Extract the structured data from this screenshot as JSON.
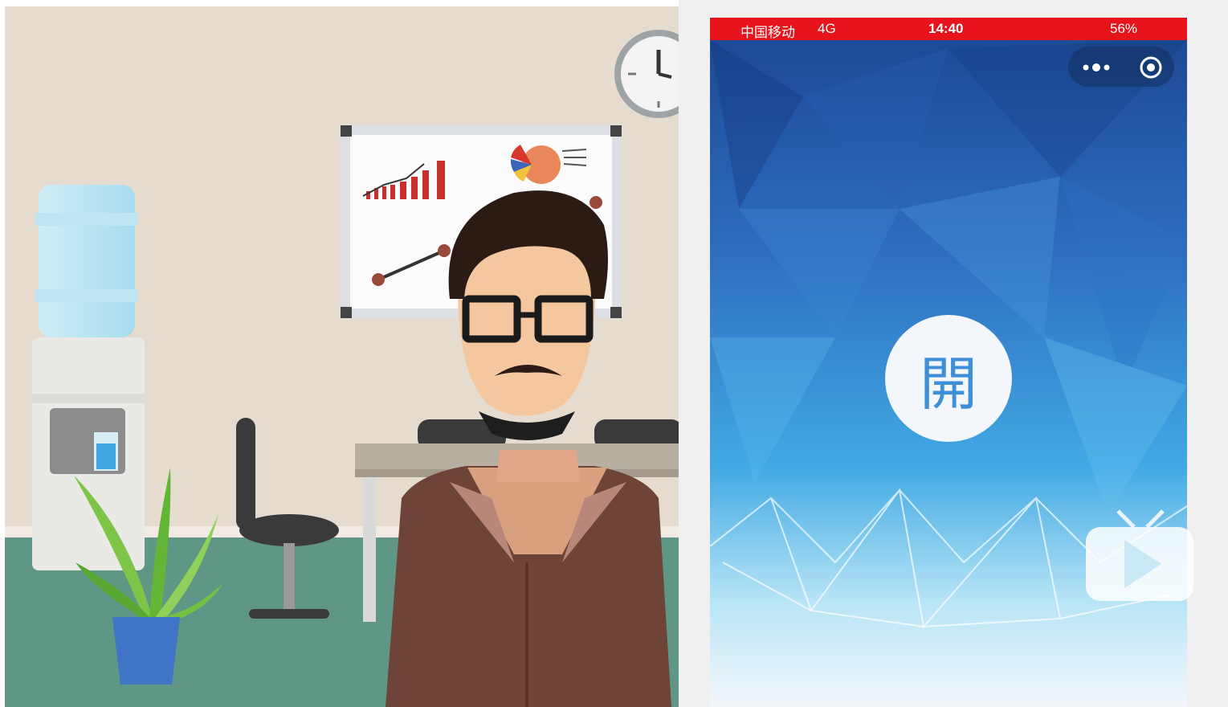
{
  "status_bar": {
    "carrier": "中国移动",
    "network": "4G",
    "time": "14:40",
    "battery": "56%"
  },
  "mini_program": {
    "open_button_label": "開",
    "menu_icon": "more-dots-icon",
    "close_icon": "target-circle-icon"
  },
  "video_badge_icon": "tv-play-icon",
  "colors": {
    "status_red": "#e8141b",
    "poly_blue_dark": "#1e4c9a",
    "poly_blue_light": "#3aa9e6",
    "wall": "#e5d9cc",
    "floor": "#5c9583",
    "jacket": "#6e4538"
  }
}
